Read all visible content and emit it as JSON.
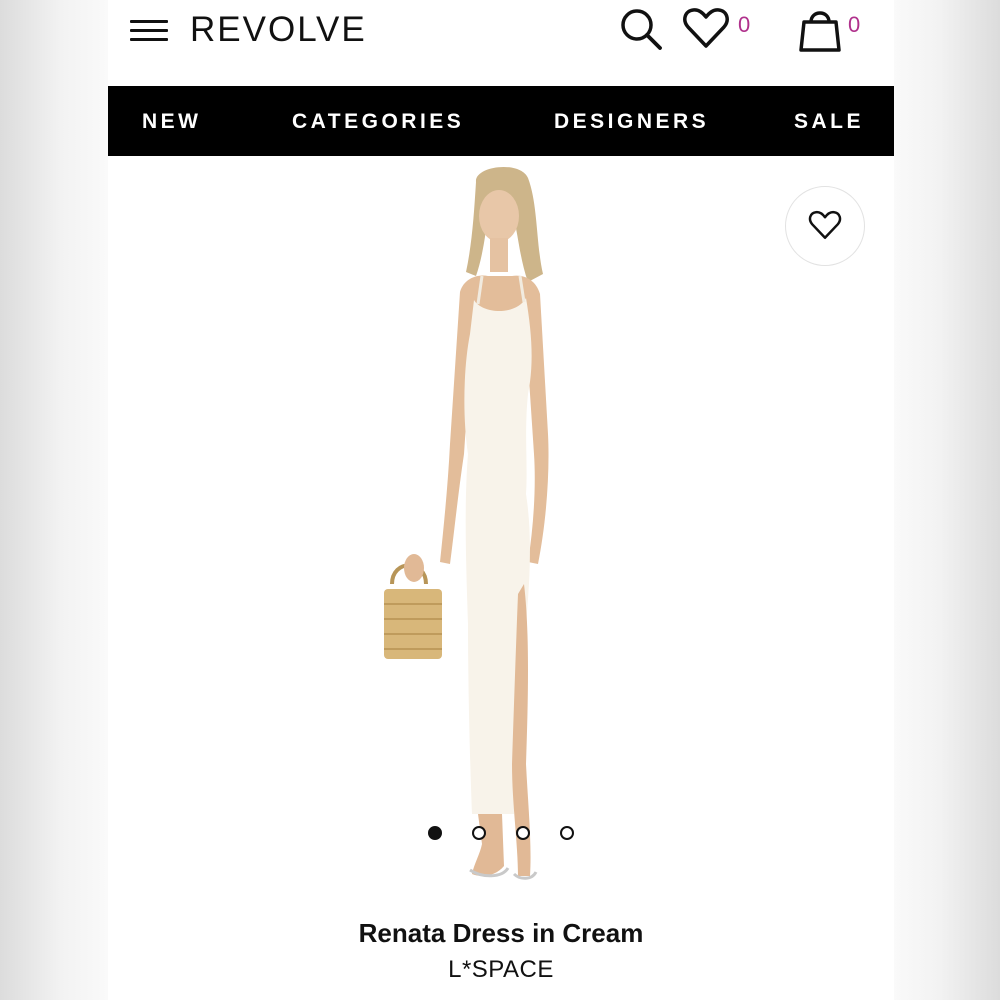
{
  "header": {
    "brand": "REVOLVE",
    "wishlist_count": "0",
    "bag_count": "0"
  },
  "nav": {
    "items": [
      "NEW",
      "CATEGORIES",
      "DESIGNERS",
      "SALE"
    ]
  },
  "product": {
    "title": "Renata Dress in Cream",
    "designer": "L*SPACE",
    "image_count": 4,
    "active_image_index": 0
  },
  "colors": {
    "accent_count": "#b0318c",
    "nav_bg": "#000000"
  },
  "icons": {
    "menu": "hamburger-icon",
    "search": "search-icon",
    "wishlist": "heart-icon",
    "bag": "shopping-bag-icon",
    "favorite": "heart-outline-icon"
  }
}
